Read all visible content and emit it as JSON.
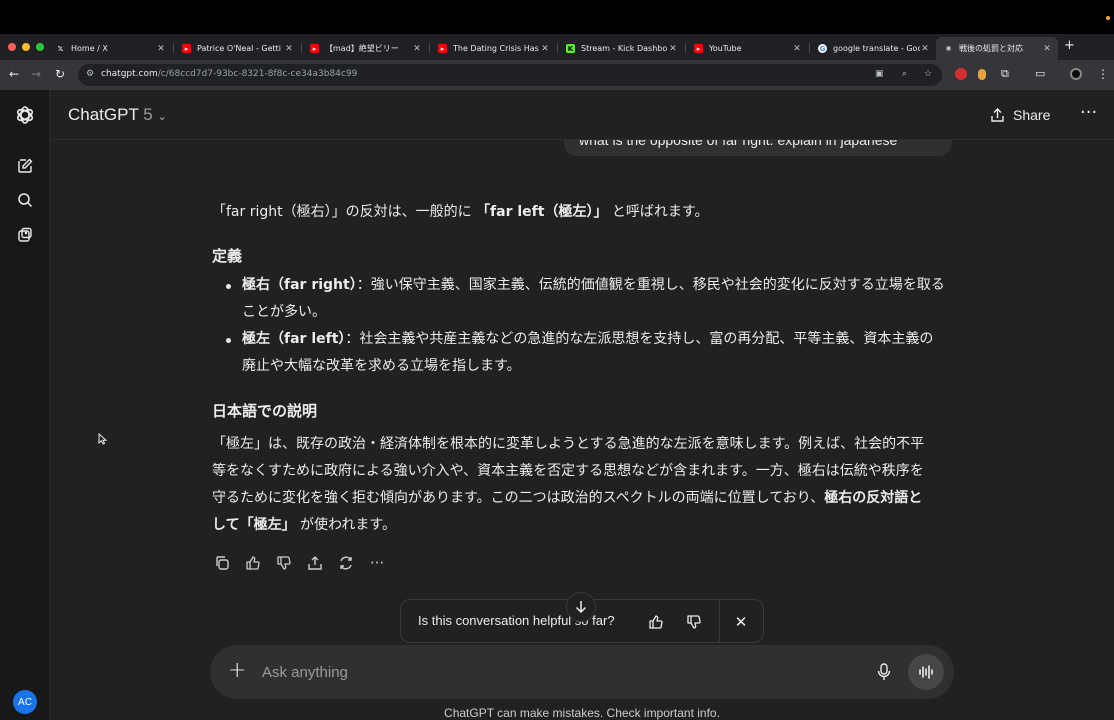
{
  "browser": {
    "tabs": [
      {
        "label": "Home / X",
        "favicon": "x-favicon",
        "color": "#ffffff"
      },
      {
        "label": "Patrice O'Neal - Getti",
        "favicon": "youtube-favicon",
        "color": "#ff0000"
      },
      {
        "label": "【mad】絶望ビリー",
        "favicon": "youtube-favicon",
        "color": "#ff0000"
      },
      {
        "label": "The Dating Crisis Has",
        "favicon": "youtube-favicon",
        "color": "#ff0000"
      },
      {
        "label": "Stream - Kick Dashbo",
        "favicon": "kick-favicon",
        "color": "#53fc18"
      },
      {
        "label": "YouTube",
        "favicon": "youtube-favicon",
        "color": "#ff0000"
      },
      {
        "label": "google translate - Goo",
        "favicon": "google-favicon",
        "color": "#4285f4"
      },
      {
        "label": "戦後の処罰と対応",
        "favicon": "chatgpt-favicon",
        "color": "#cccccc",
        "active": true
      }
    ],
    "url_host": "chatgpt.com",
    "url_path": "/c/68ccd7d7-93bc-8321-8f8c-ce34a3b84c99"
  },
  "header": {
    "model_name": "ChatGPT",
    "model_version": "5",
    "share_label": "Share"
  },
  "user_message": "what is the opposite of far right. explain in japanese",
  "answer": {
    "intro_pre": "「far right（極右）」の反対は、一般的に ",
    "intro_bold": "「far left（極左）」",
    "intro_post": " と呼ばれます。",
    "def_heading": "定義",
    "bullets": [
      {
        "term": "極右（far right）",
        "text": "：強い保守主義、国家主義、伝統的価値観を重視し、移民や社会的変化に反対する立場を取る",
        "text2": "ことが多い。"
      },
      {
        "term": "極左（far left）",
        "text": "：社会主義や共産主義などの急進的な左派思想を支持し、富の再分配、平等主義、資本主義の",
        "text2": "廃止や大幅な改革を求める立場を指します。"
      }
    ],
    "explain_heading": "日本語での説明",
    "para_line1": "「極左」は、既存の政治・経済体制を根本的に変革しようとする急進的な左派を意味します。例えば、社会的不平",
    "para_line2": "等をなくすために政府による強い介入や、資本主義を否定する思想などが含まれます。一方、極右は伝統や秩序を",
    "para_line3_pre": "守るために変化を強く拒む傾向があります。この二つは政治的スペクトルの両端に位置しており、",
    "para_line3_bold": "極右の反対語と",
    "para_line4_bold_pre": "して「極左」",
    "para_line4_post": " が使われます。"
  },
  "feedback": {
    "question": "Is this conversation helpful so far?"
  },
  "composer": {
    "placeholder": "Ask anything"
  },
  "disclaimer": "ChatGPT can make mistakes. Check important info.",
  "user_avatar": "AC"
}
